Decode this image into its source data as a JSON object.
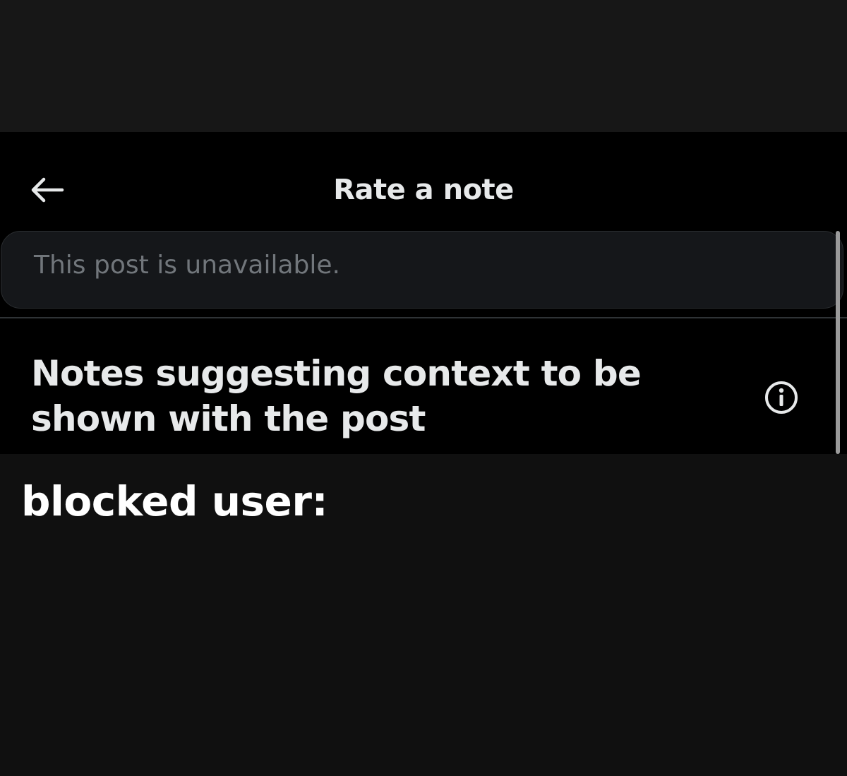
{
  "header": {
    "title": "Rate a note",
    "back_icon": "back-arrow-icon"
  },
  "post": {
    "text": "This post is unavailable."
  },
  "notes_section": {
    "title": "Notes suggesting context to be shown with the post",
    "info_icon": "info-icon"
  },
  "caption": {
    "text": "blocked user:"
  },
  "colors": {
    "page_background": "#101010",
    "top_band": "#171717",
    "app_background": "#000000",
    "primary_text": "#e7e9ea",
    "secondary_text": "#71767b",
    "card_background": "#15171a",
    "divider": "#2f3336",
    "caption_text": "#ffffff"
  }
}
